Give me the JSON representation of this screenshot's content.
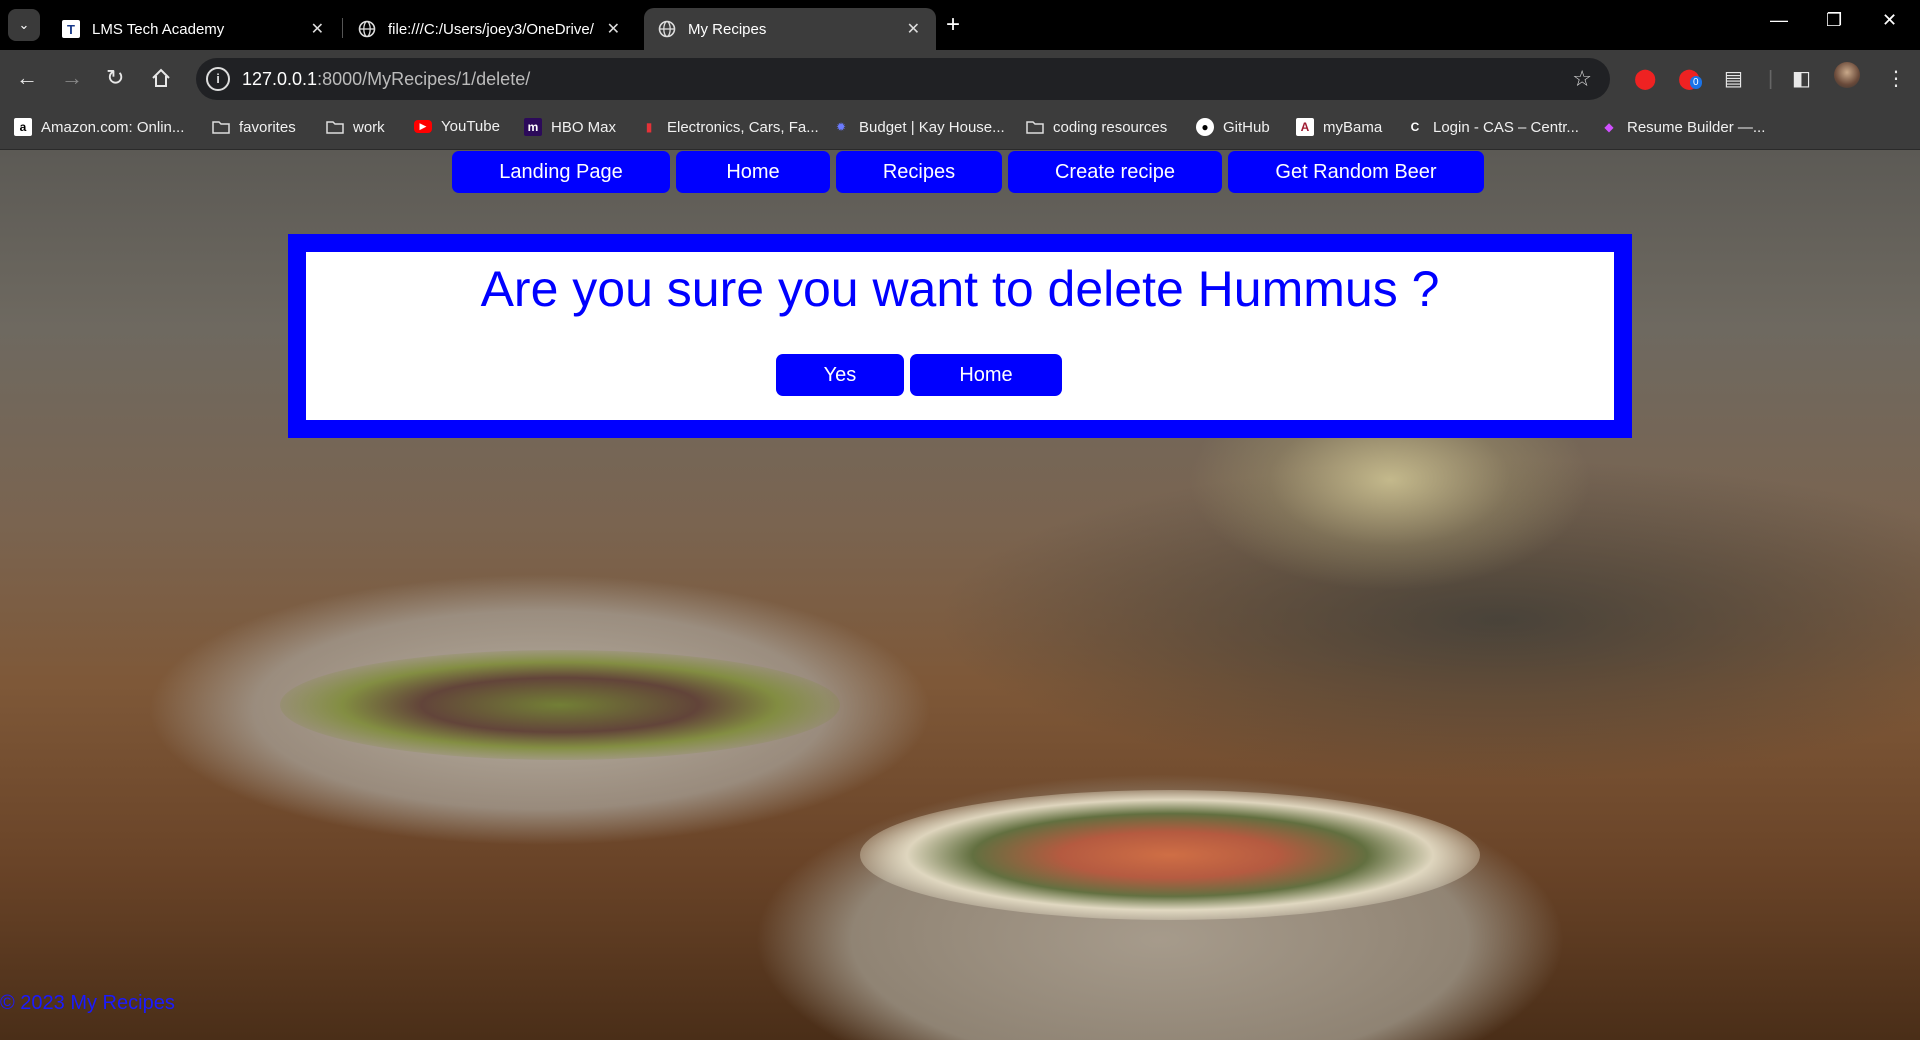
{
  "browser": {
    "tabs": [
      {
        "title": "LMS Tech Academy",
        "active": false,
        "icon": "lms-logo-icon"
      },
      {
        "title": "file:///C:/Users/joey3/OneDrive/",
        "active": false,
        "icon": "globe-icon"
      },
      {
        "title": "My Recipes",
        "active": true,
        "icon": "globe-icon"
      }
    ],
    "url_host": "127.0.0.1",
    "url_path": ":8000/MyRecipes/1/delete/",
    "extension_badge": "0",
    "bookmarks": [
      {
        "label": "Amazon.com: Onlin...",
        "icon": "amazon-icon"
      },
      {
        "label": "favorites",
        "icon": "folder-icon"
      },
      {
        "label": "work",
        "icon": "folder-icon"
      },
      {
        "label": "YouTube",
        "icon": "youtube-icon"
      },
      {
        "label": "HBO Max",
        "icon": "hbo-max-icon"
      },
      {
        "label": "Electronics, Cars, Fa...",
        "icon": "ebay-icon"
      },
      {
        "label": "Budget | Kay House...",
        "icon": "budget-icon"
      },
      {
        "label": "coding resources",
        "icon": "folder-icon"
      },
      {
        "label": "GitHub",
        "icon": "github-icon"
      },
      {
        "label": "myBama",
        "icon": "mybama-icon"
      },
      {
        "label": "Login - CAS – Centr...",
        "icon": "cas-icon"
      },
      {
        "label": "Resume Builder —...",
        "icon": "resume-builder-icon"
      }
    ]
  },
  "page": {
    "nav": [
      "Landing Page",
      "Home",
      "Recipes",
      "Create recipe",
      "Get Random Beer"
    ],
    "delete_prompt": "Are you sure you want to delete Hummus ?",
    "yes_label": "Yes",
    "home_label": "Home",
    "footer": "© 2023 My Recipes"
  },
  "colors": {
    "accent": "#0000ff",
    "browser_frame": "#000000",
    "toolbar": "#3c3c3c"
  }
}
